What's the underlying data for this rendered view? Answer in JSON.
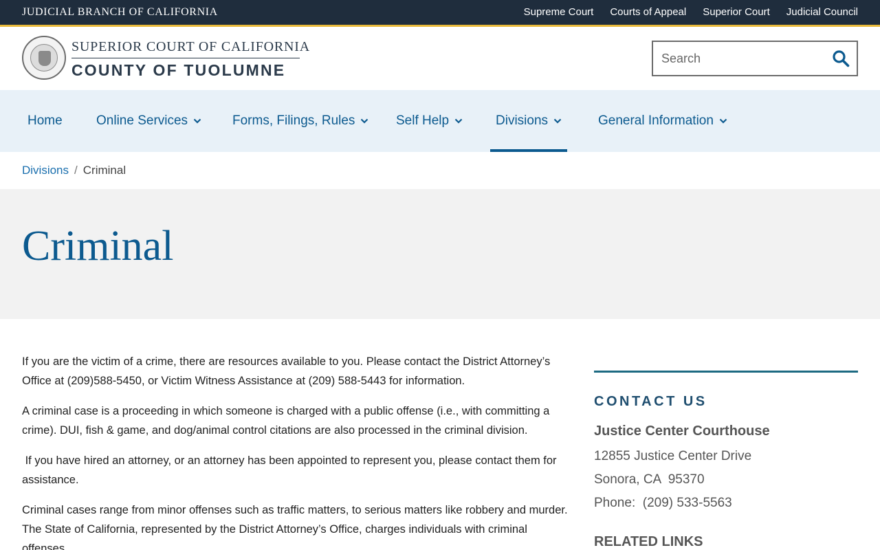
{
  "topbar": {
    "brand": "JUDICIAL BRANCH OF CALIFORNIA",
    "links": [
      "Supreme Court",
      "Courts of Appeal",
      "Superior Court",
      "Judicial Council"
    ]
  },
  "header": {
    "logo_line1": "SUPERIOR COURT OF CALIFORNIA",
    "logo_line2": "COUNTY OF TUOLUMNE",
    "search_placeholder": "Search"
  },
  "nav": {
    "items": [
      {
        "label": "Home",
        "dropdown": false
      },
      {
        "label": "Online Services",
        "dropdown": true
      },
      {
        "label": "Forms, Filings, Rules",
        "dropdown": true
      },
      {
        "label": "Self Help",
        "dropdown": true
      },
      {
        "label": "Divisions",
        "dropdown": true,
        "active": true
      },
      {
        "label": "General Information",
        "dropdown": true
      }
    ]
  },
  "breadcrumb": {
    "parent": "Divisions",
    "separator": "/",
    "current": "Criminal"
  },
  "page": {
    "title": "Criminal",
    "paragraphs": [
      "If you are the victim of a crime, there are resources available to you. Please contact the District Attorney’s Office at (209)588-5450, or Victim Witness Assistance at (209) 588-5443 for information.",
      "A criminal case is a proceeding in which someone is charged with a public offense (i.e., with committing a crime). DUI, fish & game, and dog/animal control citations are also processed in the criminal division.",
      " If you have hired an attorney, or an attorney has been appointed to represent you, please contact them for assistance.",
      "Criminal cases range from minor offenses such as traffic matters, to serious matters like robbery and murder. The State of California, represented by the District Attorney’s Office, charges individuals with criminal offenses."
    ]
  },
  "sidebar": {
    "contact_heading": "CONTACT US",
    "court_name": "Justice Center Courthouse",
    "address_line1": "12855 Justice Center Drive",
    "address_line2": "Sonora, CA  95370",
    "phone": "Phone:  (209) 533-5563",
    "related_heading": "RELATED LINKS"
  },
  "colors": {
    "topbar": "#1f2d3d",
    "accent_gold": "#e8b93a",
    "nav_bg": "#e8f1f8",
    "link_blue": "#0c5a8f",
    "hero_bg": "#f2f2f2"
  }
}
